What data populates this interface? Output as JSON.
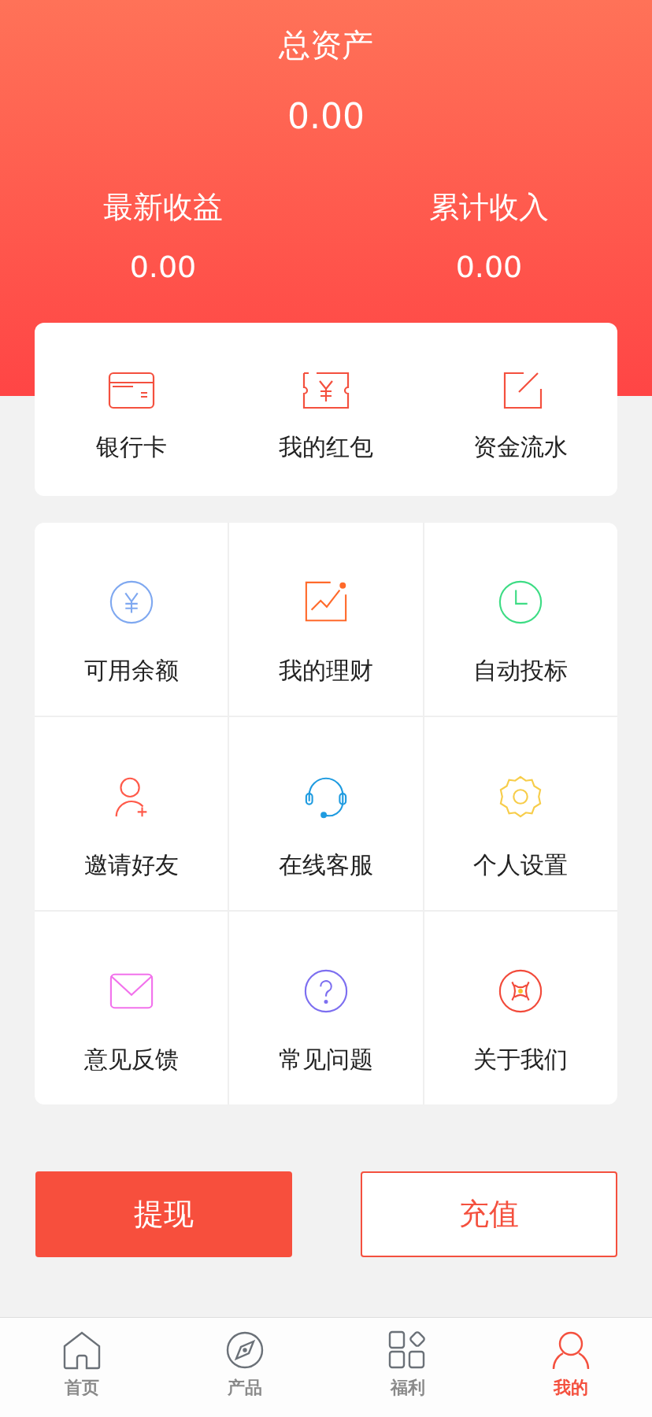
{
  "header": {
    "title": "总资产",
    "total": "0.00",
    "stats": [
      {
        "label": "最新收益",
        "value": "0.00"
      },
      {
        "label": "累计收入",
        "value": "0.00"
      }
    ]
  },
  "shortcuts": [
    {
      "label": "银行卡"
    },
    {
      "label": "我的红包"
    },
    {
      "label": "资金流水"
    }
  ],
  "grid": [
    {
      "label": "可用余额",
      "color": "#7fa8f0"
    },
    {
      "label": "我的理财",
      "color": "#ff6a2b"
    },
    {
      "label": "自动投标",
      "color": "#3ddc84"
    },
    {
      "label": "邀请好友",
      "color": "#ff5a4a"
    },
    {
      "label": "在线客服",
      "color": "#1e9be0"
    },
    {
      "label": "个人设置",
      "color": "#f7cd4a"
    },
    {
      "label": "意见反馈",
      "color": "#f272ec"
    },
    {
      "label": "常见问题",
      "color": "#7d6ff0"
    },
    {
      "label": "关于我们",
      "color": "#f24a3a"
    }
  ],
  "buttons": [
    {
      "label": "提现",
      "kind": "filled"
    },
    {
      "label": "充值",
      "kind": "outline"
    }
  ],
  "tabs": [
    {
      "label": "首页",
      "selected": false
    },
    {
      "label": "产品",
      "selected": false
    },
    {
      "label": "福利",
      "selected": false
    },
    {
      "label": "我的",
      "selected": true
    }
  ]
}
